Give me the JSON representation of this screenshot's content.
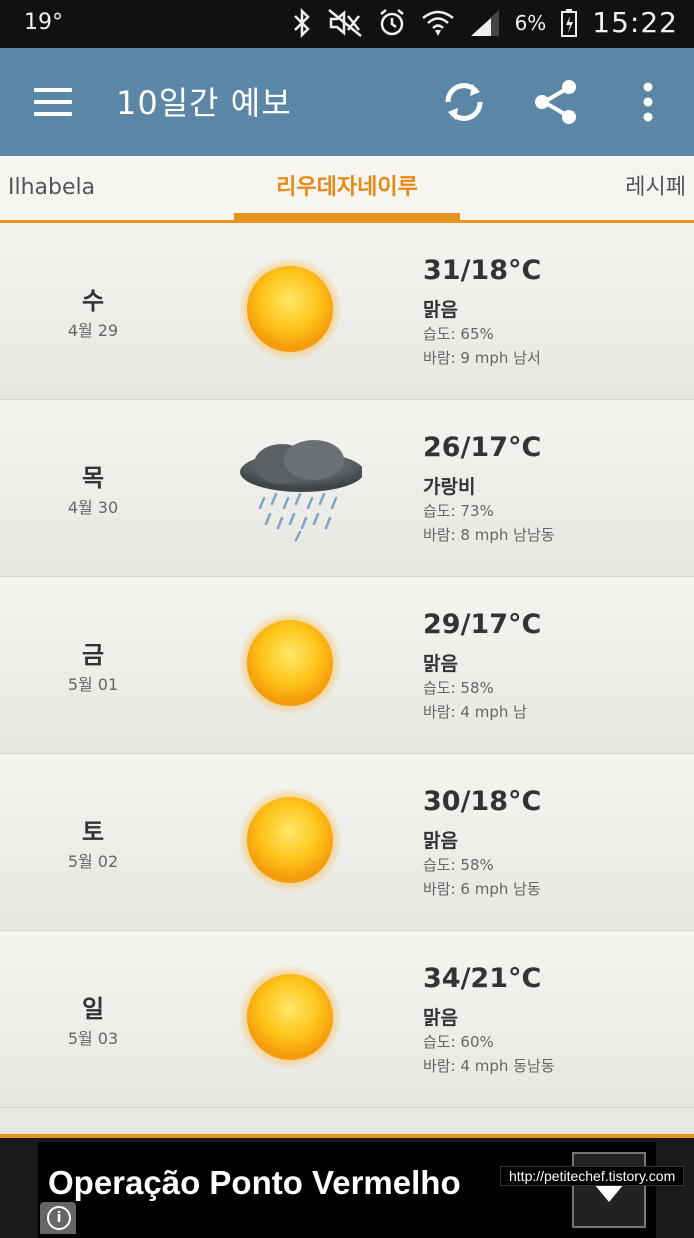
{
  "status_bar": {
    "temperature": "19°",
    "battery_pct": "6%",
    "time": "15:22"
  },
  "app_bar": {
    "title": "10일간 예보",
    "icons": [
      "menu-icon",
      "refresh-icon",
      "share-icon",
      "more-vert-icon"
    ]
  },
  "tabs": [
    {
      "label": "Ilhabela",
      "selected": false
    },
    {
      "label": "리우데자네이루",
      "selected": true
    },
    {
      "label": "레시페",
      "selected": false
    }
  ],
  "forecast": [
    {
      "day": "수",
      "date": "4월 29",
      "icon": "sunny-icon",
      "temp": "31/18°C",
      "condition": "맑음",
      "humidity": "습도: 65%",
      "wind": "바람: 9 mph 남서"
    },
    {
      "day": "목",
      "date": "4월 30",
      "icon": "rain-cloud-icon",
      "temp": "26/17°C",
      "condition": "가랑비",
      "humidity": "습도: 73%",
      "wind": "바람: 8 mph 남남동"
    },
    {
      "day": "금",
      "date": "5월 01",
      "icon": "sunny-icon",
      "temp": "29/17°C",
      "condition": "맑음",
      "humidity": "습도: 58%",
      "wind": "바람: 4 mph 남"
    },
    {
      "day": "토",
      "date": "5월 02",
      "icon": "sunny-icon",
      "temp": "30/18°C",
      "condition": "맑음",
      "humidity": "습도: 58%",
      "wind": "바람: 6 mph 남동"
    },
    {
      "day": "일",
      "date": "5월 03",
      "icon": "sunny-icon",
      "temp": "34/21°C",
      "condition": "맑음",
      "humidity": "습도: 60%",
      "wind": "바람: 4 mph 동남동"
    }
  ],
  "ad": {
    "text": "Operação Ponto Vermelho",
    "url": "http://petitechef.tistory.com"
  },
  "colors": {
    "app_bar": "#5b86a6",
    "accent": "#e8931f",
    "status_bar": "#111111"
  }
}
